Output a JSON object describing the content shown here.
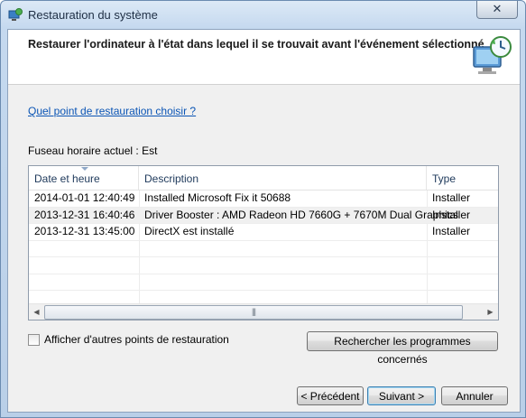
{
  "window": {
    "title": "Restauration du système",
    "close_label": "✕"
  },
  "header": {
    "title": "Restaurer l'ordinateur à l'état dans lequel il se trouvait avant l'événement sélectionné"
  },
  "help_link": "Quel point de restauration choisir ?",
  "timezone_label": "Fuseau horaire actuel : Est",
  "list": {
    "columns": [
      "Date et heure",
      "Description",
      "Type"
    ],
    "sorted_column": "Date et heure",
    "rows": [
      {
        "date": "2014-01-01 12:40:49",
        "description": "Installed Microsoft Fix it 50688",
        "type": "Installer"
      },
      {
        "date": "2013-12-31 16:40:46",
        "description": "Driver Booster : AMD Radeon HD 7660G + 7670M Dual Graphics",
        "type": "Installer"
      },
      {
        "date": "2013-12-31 13:45:00",
        "description": "DirectX est installé",
        "type": "Installer"
      }
    ]
  },
  "show_more_checkbox": {
    "label": "Afficher d'autres points de restauration",
    "checked": false
  },
  "buttons": {
    "search": "Rechercher les programmes concernés",
    "prev": "< Précédent",
    "next": "Suivant >",
    "cancel": "Annuler"
  },
  "colors": {
    "link": "#0b55b5",
    "header_text": "#1e395b",
    "titlebar": "#c5d9ef"
  },
  "icons": [
    "system-restore-icon",
    "close-icon",
    "restore-clock-icon",
    "sort-ascending-icon",
    "scroll-left-icon",
    "scroll-right-icon",
    "scroll-grip-icon"
  ]
}
